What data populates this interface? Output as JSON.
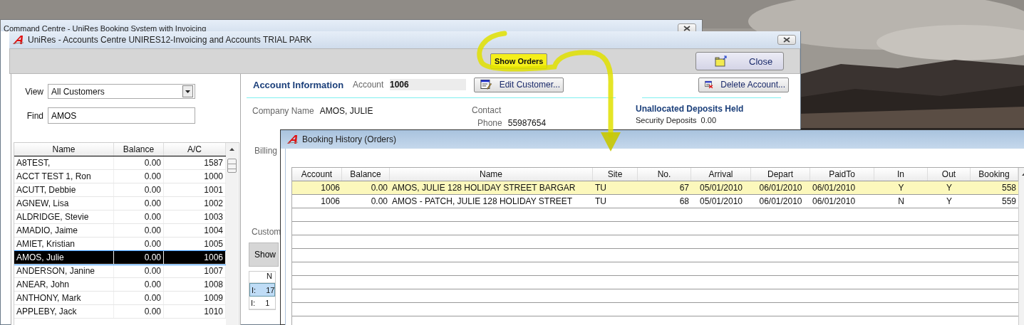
{
  "back_window": {
    "title": "Command Centre - UniRes Booking System with Invoicing"
  },
  "accounts_window": {
    "title": "UniRes - Accounts Centre UNIRES12-Invoicing and Accounts TRIAL PARK",
    "toolbar": {
      "show_orders": "Show Orders",
      "close": "Close"
    },
    "view": {
      "label": "View",
      "value": "All Customers"
    },
    "find": {
      "label": "Find",
      "value": "AMOS"
    },
    "customers": {
      "columns": [
        "Name",
        "Balance",
        "A/C"
      ],
      "rows": [
        {
          "name": "A8TEST,",
          "balance": "0.00",
          "ac": "1587",
          "selected": false
        },
        {
          "name": "ACCT TEST 1, Ron",
          "balance": "0.00",
          "ac": "1000",
          "selected": false
        },
        {
          "name": "ACUTT, Debbie",
          "balance": "0.00",
          "ac": "1001",
          "selected": false
        },
        {
          "name": "AGNEW, Lisa",
          "balance": "0.00",
          "ac": "1002",
          "selected": false
        },
        {
          "name": "ALDRIDGE, Stevie",
          "balance": "0.00",
          "ac": "1003",
          "selected": false
        },
        {
          "name": "AMADIO, Jaime",
          "balance": "0.00",
          "ac": "1004",
          "selected": false
        },
        {
          "name": "AMIET, Kristian",
          "balance": "0.00",
          "ac": "1005",
          "selected": false
        },
        {
          "name": "AMOS, Julie",
          "balance": "0.00",
          "ac": "1006",
          "selected": true
        },
        {
          "name": "ANDERSON, Janine",
          "balance": "0.00",
          "ac": "1007",
          "selected": false
        },
        {
          "name": "ANEAR, John",
          "balance": "0.00",
          "ac": "1008",
          "selected": false
        },
        {
          "name": "ANTHONY, Mark",
          "balance": "0.00",
          "ac": "1009",
          "selected": false
        },
        {
          "name": "APPLEBY, Jack",
          "balance": "0.00",
          "ac": "1010",
          "selected": false
        }
      ]
    },
    "account": {
      "heading": "Account Information",
      "account_label": "Account",
      "account_value": "1006",
      "edit_button": "Edit Customer...",
      "delete_button": "Delete Account...",
      "company_label": "Company Name",
      "company_value": "AMOS, JULIE",
      "contact_label": "Contact",
      "phone_label": "Phone",
      "phone_value": "55987654",
      "deposits_heading": "Unallocated Deposits Held",
      "security_label": "Security Deposits",
      "security_value": "0.00",
      "billing_label": "Billing",
      "customer_label": "Custom",
      "show_button": "Show",
      "mini_table": {
        "column": "N",
        "rows": [
          {
            "type": "I:",
            "number": "17",
            "selected": true
          },
          {
            "type": "I:",
            "number": "1",
            "selected": false
          }
        ]
      }
    }
  },
  "booking_window": {
    "title": "Booking History (Orders)",
    "columns": [
      "Account",
      "Balance",
      "Name",
      "Site",
      "No.",
      "Arrival",
      "Depart",
      "PaidTo",
      "In",
      "Out",
      "Booking"
    ],
    "rows": [
      {
        "selected": true,
        "cells": [
          "1006",
          "0.00",
          "AMOS, JULIE 128 HOLIDAY STREET BARGAR",
          "TU",
          "67",
          "05/01/2010",
          "06/01/2010",
          "06/01/2010",
          "Y",
          "Y",
          "558"
        ]
      },
      {
        "selected": false,
        "cells": [
          "1006",
          "0.00",
          "AMOS - PATCH, JULIE 128 HOLIDAY STREET",
          "TU",
          "68",
          "05/01/2010",
          "06/01/2010",
          "06/01/2010",
          "N",
          "Y",
          "559"
        ]
      }
    ]
  }
}
